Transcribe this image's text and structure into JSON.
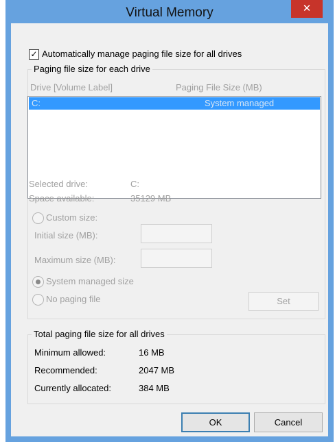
{
  "window": {
    "title": "Virtual Memory",
    "close_glyph": "✕"
  },
  "auto_manage": {
    "label": "Automatically manage paging file size for all drives",
    "checked": true
  },
  "group1": {
    "legend": "Paging file size for each drive",
    "col_drive": "Drive  [Volume Label]",
    "col_size": "Paging File Size (MB)",
    "rows": [
      {
        "drive": "C:",
        "size": "System managed"
      }
    ],
    "selected_drive_label": "Selected drive:",
    "selected_drive_value": "C:",
    "space_label": "Space available:",
    "space_value": "35129 MB",
    "custom_size": "Custom size:",
    "initial_size": "Initial size (MB):",
    "maximum_size": "Maximum size (MB):",
    "system_managed": "System managed size",
    "no_paging": "No paging file",
    "set": "Set"
  },
  "group2": {
    "legend": "Total paging file size for all drives",
    "min_label": "Minimum allowed:",
    "min_value": "16 MB",
    "rec_label": "Recommended:",
    "rec_value": "2047 MB",
    "cur_label": "Currently allocated:",
    "cur_value": "384 MB"
  },
  "buttons": {
    "ok": "OK",
    "cancel": "Cancel"
  },
  "colors": {
    "title_bar": "#66a2df",
    "close": "#c7342a",
    "selection": "#3399ff"
  }
}
